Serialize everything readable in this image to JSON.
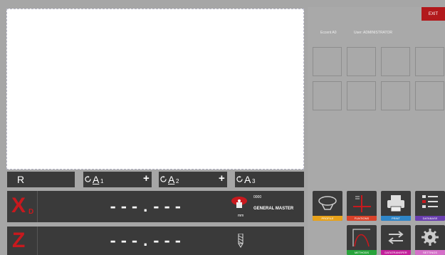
{
  "header": {
    "exit_label": "EXIT",
    "file": "Eccent A0",
    "user": "User: ADMINISTRATOR"
  },
  "axes": {
    "r_label": "R",
    "a1_label": "A",
    "a1_sub": "1",
    "a2_label": "A",
    "a2_sub": "2",
    "a3_label": "A",
    "a3_sub": "3",
    "plus": "+",
    "x_label": "X",
    "x_sub": "D",
    "z_label": "Z",
    "x_value": "---.---",
    "z_value": "---.---"
  },
  "tool": {
    "number": "0000",
    "name": "GENERAL MASTER",
    "unit": "mm"
  },
  "functions": [
    {
      "label": "PROFILE",
      "color": "#e8a21a",
      "icon": "profile-icon"
    },
    {
      "label": "FUNTIONS",
      "color": "#d9432a",
      "icon": "functions-icon"
    },
    {
      "label": "PRINT",
      "color": "#2f86c8",
      "icon": "printer-icon"
    },
    {
      "label": "DATABASE",
      "color": "#6a3fb0",
      "icon": "database-icon"
    },
    {
      "label": "METHODS",
      "color": "#27a33a",
      "icon": "methods-icon"
    },
    {
      "label": "DATATRANSFER",
      "color": "#c3209b",
      "icon": "transfer-icon"
    },
    {
      "label": "SETTINGS",
      "color": "#d46fc8",
      "icon": "gear-icon"
    }
  ]
}
